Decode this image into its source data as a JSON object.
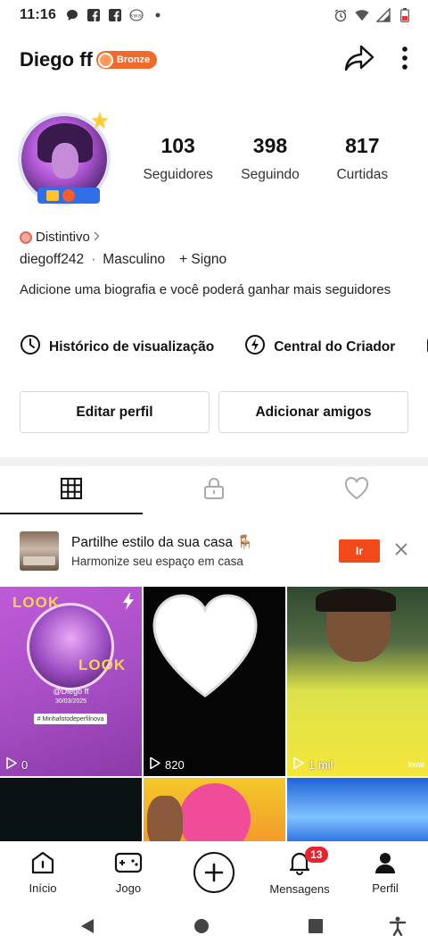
{
  "status_bar": {
    "time": "11:16",
    "left_icons": [
      "chat-bubble-icon",
      "facebook-icon",
      "facebook-icon",
      "app-icon",
      "dot-icon"
    ],
    "right_icons": [
      "alarm-icon",
      "wifi-icon",
      "signal-icon",
      "battery-icon"
    ]
  },
  "header": {
    "username": "Diego ff",
    "badge_label": "Bronze",
    "accent_color": "#f26a2a"
  },
  "stats": [
    {
      "value": "103",
      "label": "Seguidores"
    },
    {
      "value": "398",
      "label": "Seguindo"
    },
    {
      "value": "817",
      "label": "Curtidas"
    }
  ],
  "profile": {
    "distintivo": "Distintivo",
    "handle": "diegoff242",
    "separator": "·",
    "gender": "Masculino",
    "signo": "+ Signo",
    "bio": "Adicione uma biografia e você poderá ganhar mais seguidores"
  },
  "tools": [
    {
      "label": "Histórico de visualização",
      "icon": "clock-icon"
    },
    {
      "label": "Central do Criador",
      "icon": "bolt-icon"
    }
  ],
  "buttons": {
    "edit": "Editar perfil",
    "add_friends": "Adicionar amigos"
  },
  "tabs": [
    "grid-icon",
    "lock-icon",
    "heart-icon"
  ],
  "ad": {
    "title": "Partilhe estilo da sua casa",
    "emoji": "🪑",
    "subtitle": "Harmonize seu espaço em casa",
    "cta": "Ir"
  },
  "grid": [
    {
      "views": "0",
      "look_top": "LOOK",
      "look_bottom": "LOOK",
      "name": "@Diego ff",
      "date": "30/03/2025",
      "tag": "# Minhafotodeperfilnova"
    },
    {
      "views": "820"
    },
    {
      "views": "1 mil",
      "watermark": "kwai"
    },
    {
      "views": ""
    },
    {
      "views": ""
    },
    {
      "views": ""
    }
  ],
  "bottom_nav": [
    {
      "label": "Início",
      "icon": "home-icon"
    },
    {
      "label": "Jogo",
      "icon": "gamepad-icon"
    },
    {
      "label": "",
      "icon": "add-icon"
    },
    {
      "label": "Mensagens",
      "icon": "bell-icon",
      "badge": "13"
    },
    {
      "label": "Perfil",
      "icon": "person-icon"
    }
  ]
}
